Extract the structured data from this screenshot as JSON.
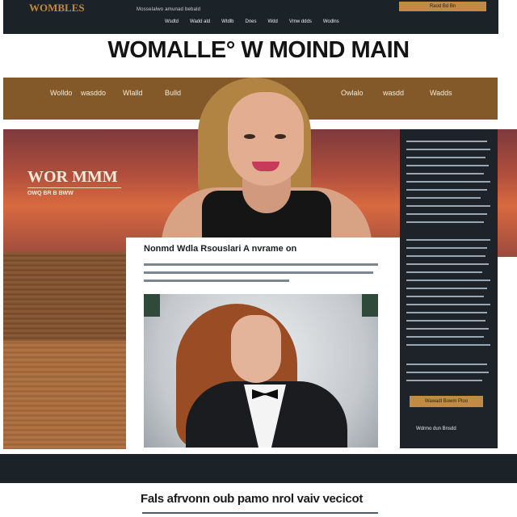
{
  "header": {
    "logo": "WOMBLES",
    "tagline": "Mosselalwo amunad bebald",
    "nav": [
      "Wsdtd",
      "Wadd ald",
      "Wtdlb",
      "Dnes",
      "Wdd",
      "Vmw ddds",
      "Wodlns"
    ],
    "cta": "Raod Bd Bn"
  },
  "headline": "WOMALLE° W MOIND MAIN",
  "main_nav": {
    "left": [
      "Wolldo",
      "wasddo",
      "Wlalld",
      "Bulld"
    ],
    "right": [
      "Owlalo",
      "wasdd",
      "Wadds"
    ]
  },
  "hero": {
    "title": "WOR MMM",
    "subtitle": "OWQ BR B BWW"
  },
  "article": {
    "title": "Nonmd Wdla Rsouslari A nvrame on"
  },
  "sidebar": {
    "button": "Wawadl Bowm Ploo",
    "footer": "Wdrmo dun Bnsdd"
  },
  "footer": {
    "text": "Fals afrvonn oub pamo nrol vaiv vecicot"
  },
  "colors": {
    "dark": "#1c2328",
    "accent": "#c28b45",
    "brown_nav": "#84592a",
    "hero_sunset": "#d86a40"
  }
}
